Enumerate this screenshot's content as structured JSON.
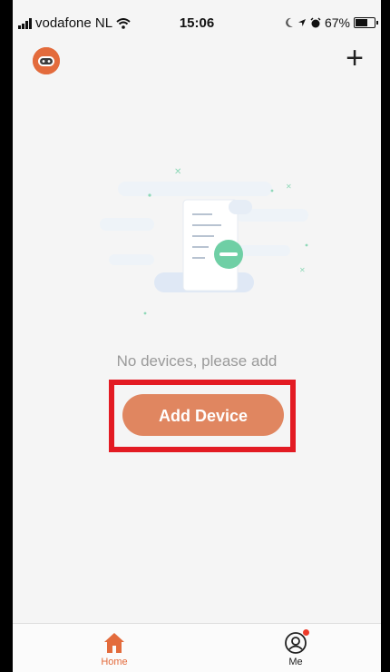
{
  "status_bar": {
    "carrier": "vodafone NL",
    "time": "15:06",
    "battery": "67%"
  },
  "header": {
    "avatar_icon": "robot-avatar-icon",
    "add_icon": "plus-icon",
    "add_symbol": "+"
  },
  "empty_state": {
    "illustration": "empty-document-icon",
    "message": "No devices, please add",
    "add_device_label": "Add Device"
  },
  "tab_bar": {
    "items": [
      {
        "label": "Home",
        "icon": "home-icon",
        "active": true
      },
      {
        "label": "Me",
        "icon": "profile-icon",
        "active": false
      }
    ]
  },
  "colors": {
    "accent": "#e36b3c",
    "button": "#e08660",
    "background": "#f5f5f5",
    "highlight": "#e31b23",
    "text_muted": "#9a9a9a"
  }
}
